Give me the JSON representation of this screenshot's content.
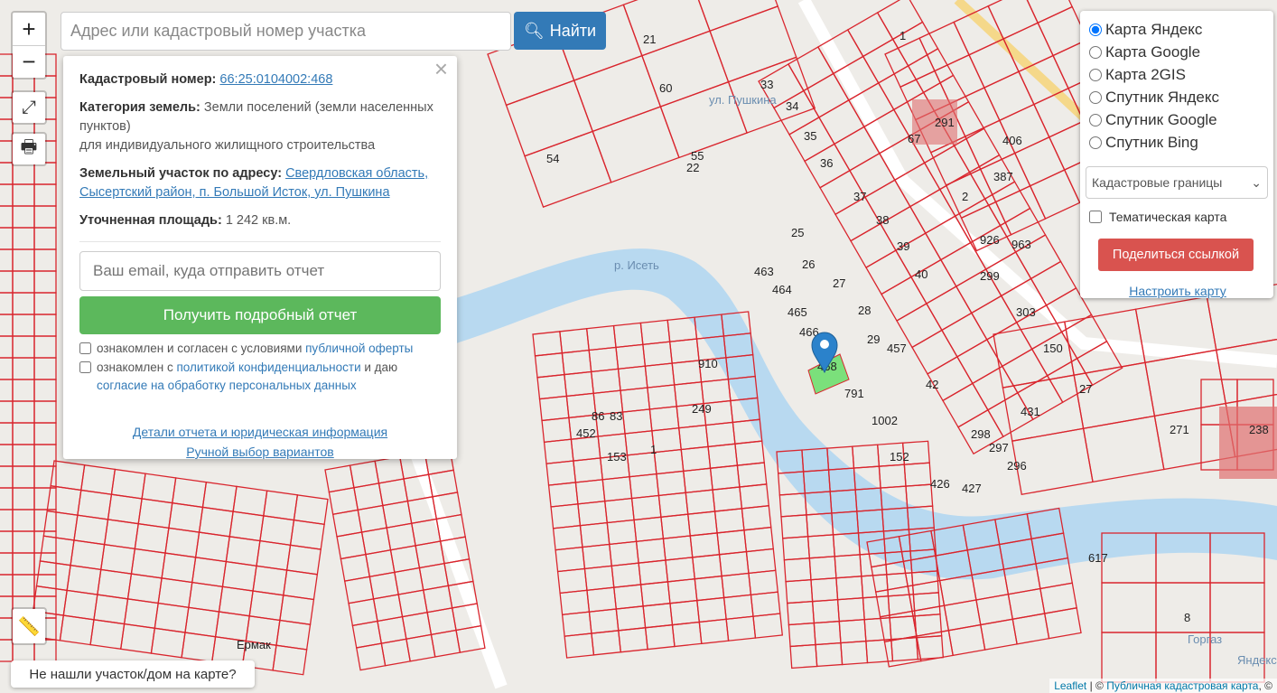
{
  "search": {
    "placeholder": "Адрес или кадастровый номер участка",
    "button": "Найти"
  },
  "controls": {
    "zoom_in": "+",
    "zoom_out": "−"
  },
  "popup": {
    "cad_label": "Кадастровый номер:",
    "cad_value": "66:25:0104002:468",
    "cat_label": "Категория земель:",
    "cat_value": "Земли поселений (земли населенных пунктов)",
    "use": "для индивидуального жилищного строительства",
    "addr_label": "Земельный участок по адресу:",
    "addr_value": "Свердловская область, Сысертский район, п. Большой Исток, ул. Пушкина",
    "area_label": "Уточненная площадь:",
    "area_value": "1 242 кв.м.",
    "email_placeholder": "Ваш email, куда отправить отчет",
    "report_button": "Получить подробный отчет",
    "agree1_text": "ознакомлен и согласен с условиями ",
    "agree1_link": "публичной оферты",
    "agree2_text": "ознакомлен с ",
    "agree2_link": "политикой конфиденциальности",
    "agree2_mid": " и даю ",
    "agree2_link2": "согласие на обработку персональных данных",
    "details_link": "Детали отчета и юридическая информация",
    "manual_link": "Ручной выбор вариантов"
  },
  "panel": {
    "maps": [
      {
        "label": "Карта Яндекс",
        "checked": true
      },
      {
        "label": "Карта Google"
      },
      {
        "label": "Карта 2GIS"
      },
      {
        "label": "Спутник Яндекс"
      },
      {
        "label": "Спутник Google"
      },
      {
        "label": "Спутник Bing"
      }
    ],
    "layer": "Кадастровые границы",
    "thematic": "Тематическая карта",
    "share": "Поделиться ссылкой",
    "configure": "Настроить карту"
  },
  "not_found": "Не нашли участок/дом на карте?",
  "attribution": {
    "leaflet": "Leaflet",
    "sep": " | © ",
    "pkk": "Публичная кадастровая карта",
    "tail": ", ©"
  },
  "map_labels": [
    "54",
    "55",
    "22",
    "463",
    "464",
    "465",
    "466",
    "468",
    "791",
    "1002",
    "42",
    "431",
    "27",
    "271",
    "238",
    "387",
    "926",
    "963",
    "299",
    "303",
    "150",
    "617",
    "р. Исеть",
    "ул. Пушкина",
    "Ермак",
    "Горгаз",
    "Яндекс",
    "33",
    "34",
    "35",
    "36",
    "37",
    "38",
    "39",
    "40",
    "28",
    "29",
    "457",
    "26",
    "27",
    "25",
    "152",
    "426",
    "427",
    "296",
    "297",
    "298",
    "910",
    "249",
    "153",
    "1",
    "452",
    "86",
    "83",
    "60",
    "21",
    "67",
    "291",
    "406",
    "2",
    "1",
    "8"
  ],
  "colors": {
    "parcel": "#d9262e",
    "river": "#b8d9f0",
    "marker": "#2b82cb",
    "selected": "#7be07b"
  }
}
